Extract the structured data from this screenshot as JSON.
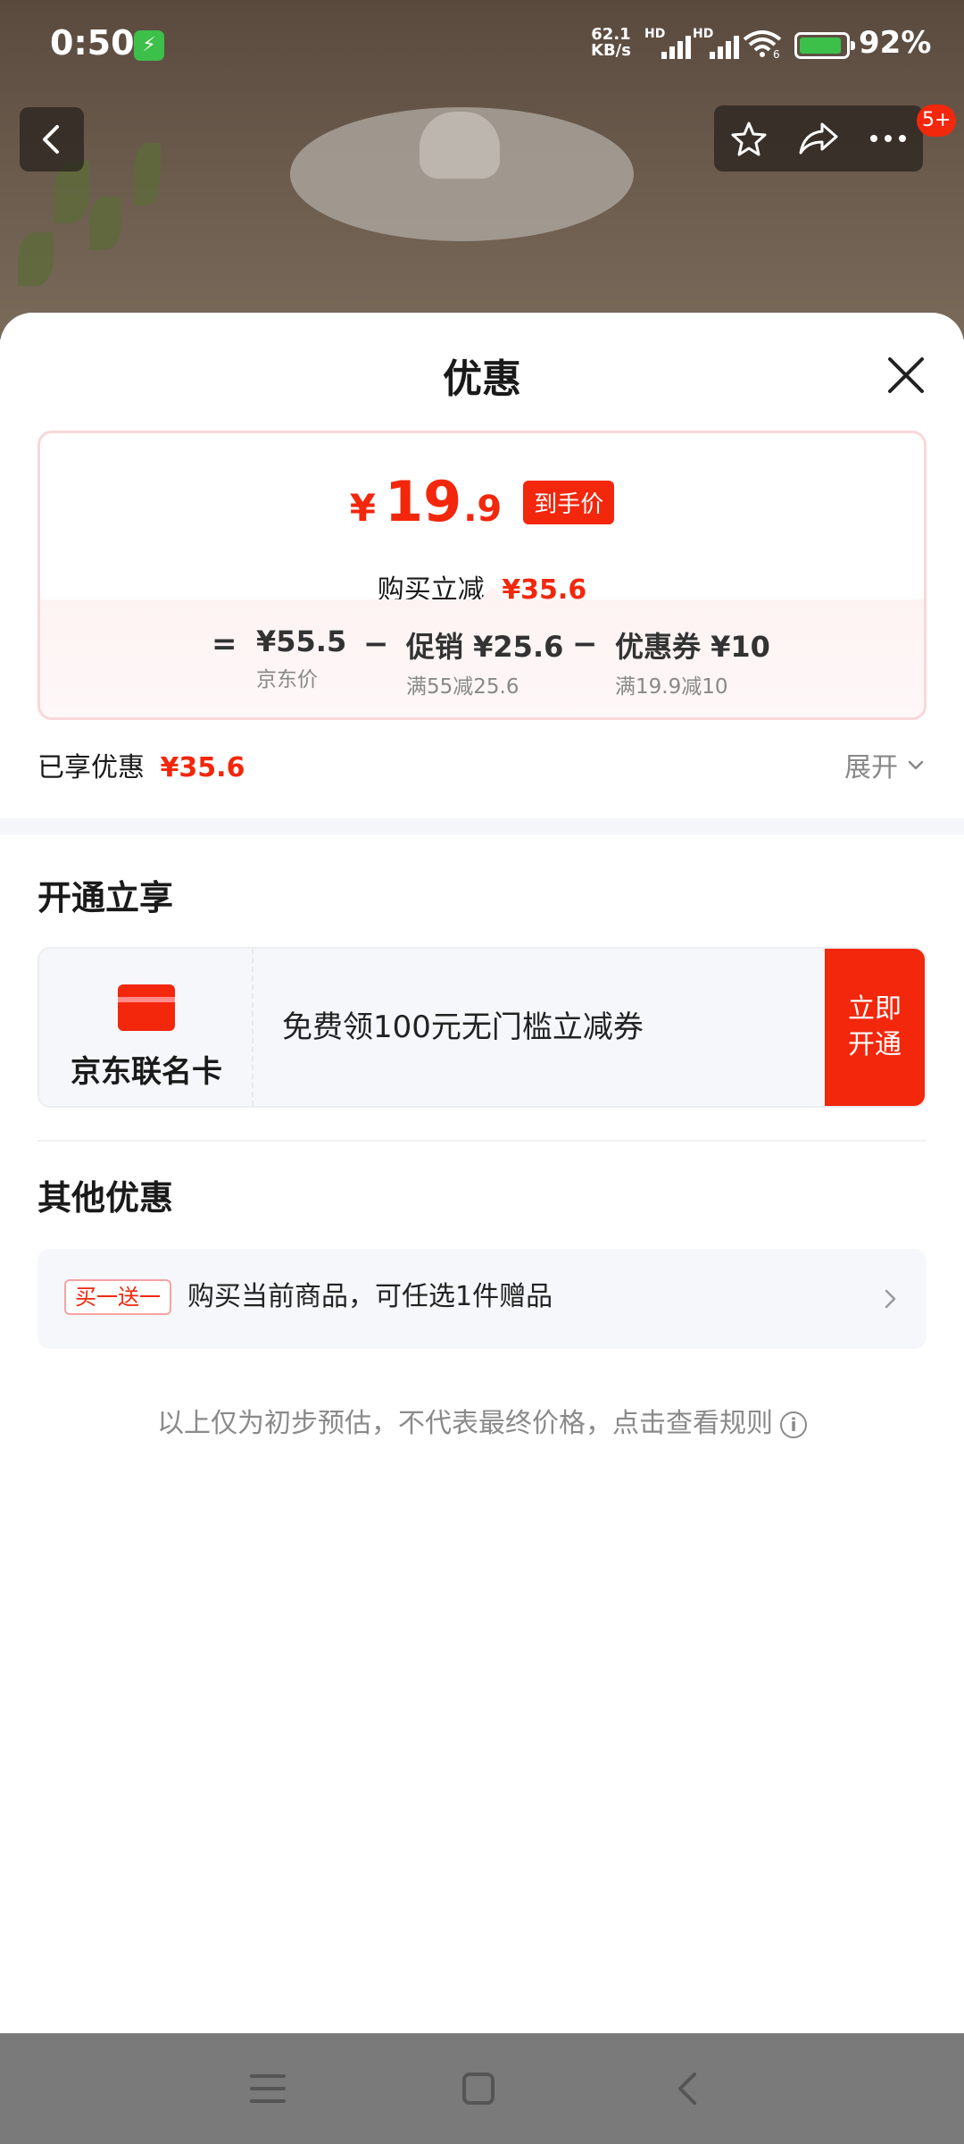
{
  "status_bar": {
    "time": "0:50",
    "net_speed_value": "62.1",
    "net_speed_unit": "KB/s",
    "sim1_label": "HD",
    "sim2_label": "HD",
    "wifi_label": "6",
    "battery_percent": "92%",
    "battery_level": 0.92
  },
  "nav": {
    "notification_badge": "5+"
  },
  "sheet": {
    "title": "优惠"
  },
  "price": {
    "yen": "¥",
    "integer": "19",
    "decimal": ".9",
    "tag": "到手价",
    "purchase_discount_label": "购买立减",
    "purchase_discount_value": "¥35.6",
    "equals": "=",
    "minus": "−",
    "breakdown": [
      {
        "value": "¥55.5",
        "sub": "京东价"
      },
      {
        "value": "促销 ¥25.6",
        "sub": "满55减25.6"
      },
      {
        "value": "优惠券 ¥10",
        "sub": "满19.9减10"
      }
    ]
  },
  "enjoyed": {
    "label": "已享优惠",
    "value": "¥35.6",
    "expand_label": "展开"
  },
  "open_section": {
    "title": "开通立享",
    "card_name": "京东联名卡",
    "description": "免费领100元无门槛立减券",
    "cta_line1": "立即",
    "cta_line2": "开通"
  },
  "other_section": {
    "title": "其他优惠",
    "tag": "买一送一",
    "text": "购买当前商品，可任选1件赠品"
  },
  "footnote": {
    "text": "以上仅为初步预估，不代表最终价格，点击查看规则",
    "info_glyph": "i"
  },
  "colors": {
    "accent_red": "#f2270c",
    "text_primary": "#1a1a1a",
    "text_secondary": "#888888"
  }
}
